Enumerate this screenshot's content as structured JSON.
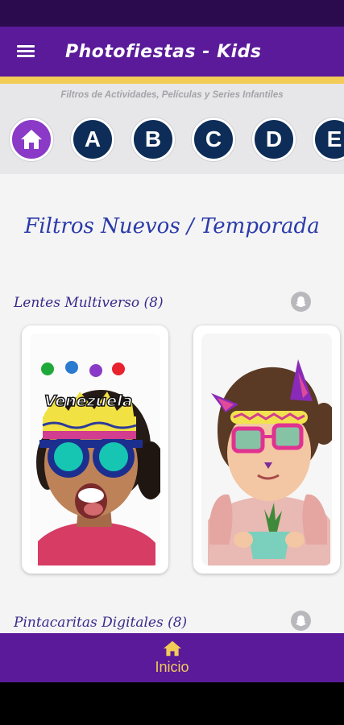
{
  "app": {
    "title": "Photofiestas - Kids"
  },
  "header": {
    "subtitle": "Filtros de Actividades, Películas y Series Infantiles"
  },
  "letter_nav": {
    "home_icon": "house-icon",
    "letters": [
      "A",
      "B",
      "C",
      "D",
      "E"
    ],
    "colors": {
      "home": "#8a3ac7",
      "letter": "#0d2d58"
    }
  },
  "main": {
    "heading": "Filtros Nuevos / Temporada",
    "sections": [
      {
        "title": "Lentes Multiverso (8)",
        "icon": "snapchat-ghost-icon"
      },
      {
        "title": "Pintacaritas Digitales (8)",
        "icon": "snapchat-ghost-icon"
      }
    ],
    "cards": [
      {
        "caption": "Venezuela"
      },
      {
        "caption": ""
      }
    ]
  },
  "bottom_nav": {
    "label": "Inicio",
    "icon": "house-icon"
  },
  "colors": {
    "primary": "#5a1a99",
    "accent": "#f2cc57"
  }
}
